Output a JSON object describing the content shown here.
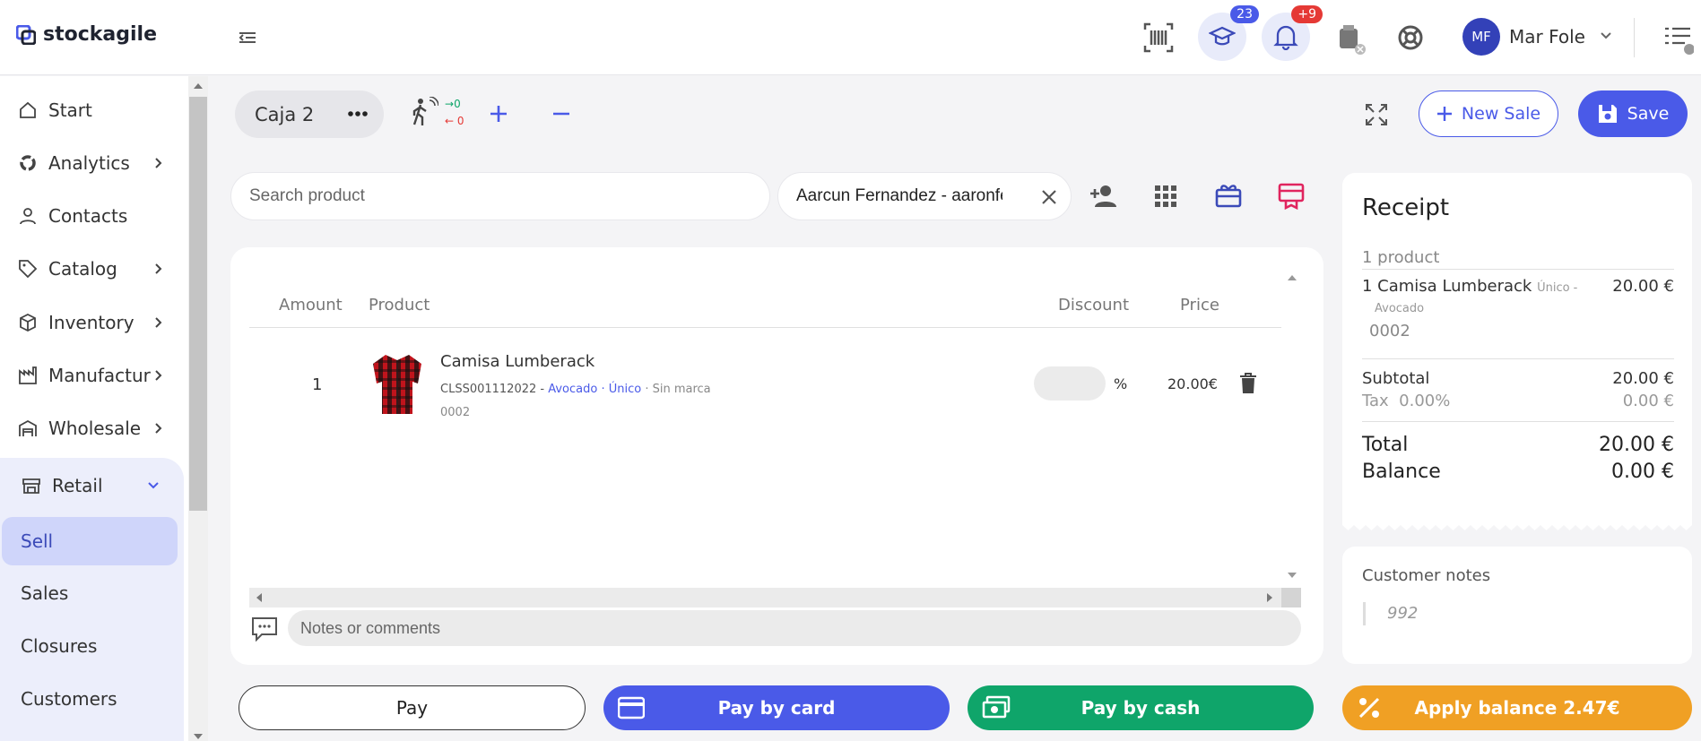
{
  "app": {
    "logo_text": "stockagile"
  },
  "header": {
    "courses_badge": "23",
    "notifications_badge": "+9",
    "user_initials": "MF",
    "user_name": "Mar Fole"
  },
  "sidebar": {
    "items": [
      {
        "label": "Start",
        "icon": "home-icon"
      },
      {
        "label": "Analytics",
        "icon": "analytics-icon"
      },
      {
        "label": "Contacts",
        "icon": "user-icon"
      },
      {
        "label": "Catalog",
        "icon": "tag-icon"
      },
      {
        "label": "Inventory",
        "icon": "box-icon"
      },
      {
        "label": "Manufactur",
        "icon": "factory-icon"
      },
      {
        "label": "Wholesale",
        "icon": "warehouse-icon"
      }
    ],
    "retail": {
      "label": "Retail",
      "icon": "store-icon"
    },
    "retail_sub": [
      {
        "label": "Sell",
        "active": true
      },
      {
        "label": "Sales"
      },
      {
        "label": "Closures"
      },
      {
        "label": "Customers"
      }
    ]
  },
  "actions": {
    "register_name": "Caja 2",
    "cash_in": "0",
    "cash_out": "0",
    "new_sale_label": "New Sale",
    "save_label": "Save"
  },
  "search": {
    "placeholder": "Search product"
  },
  "customer": {
    "value": "Aarcun Fernandez - aaronfernandez"
  },
  "table": {
    "headers": {
      "amount": "Amount",
      "product": "Product",
      "discount": "Discount",
      "price": "Price"
    },
    "rows": [
      {
        "amount": "1",
        "name": "Camisa Lumberack",
        "sku": "CLSS001112022",
        "sep1": " - ",
        "variant": "Avocado · Único",
        "sep2": " · ",
        "brand": "Sin marca",
        "code": "0002",
        "discount_unit": "%",
        "price": "20.00€"
      }
    ]
  },
  "notes": {
    "placeholder": "Notes or comments"
  },
  "receipt": {
    "title": "Receipt",
    "count": "1 product",
    "line_qty_name": "1 Camisa Lumberack",
    "line_variant1": "Único -",
    "line_variant2": "Avocado",
    "line_code": "0002",
    "line_price": "20.00 €",
    "subtotal_label": "Subtotal",
    "subtotal_value": "20.00 €",
    "tax_label": "Tax  0.00%",
    "tax_value": "0.00 €",
    "total_label": "Total",
    "total_value": "20.00 €",
    "balance_label": "Balance",
    "balance_value": "0.00 €"
  },
  "customer_notes": {
    "title": "Customer notes",
    "value": "992"
  },
  "bottom": {
    "pay_label": "Pay",
    "card_label": "Pay by card",
    "cash_label": "Pay by cash",
    "balance_label": "Apply balance 2.47€"
  },
  "colors": {
    "primary": "#4a5ae8",
    "green": "#0fa56a",
    "orange": "#f0a024",
    "badge_blue": "#4a5ae8",
    "badge_red": "#e53935",
    "link": "#4a5ae8",
    "highlight": "#dfe3fb"
  }
}
